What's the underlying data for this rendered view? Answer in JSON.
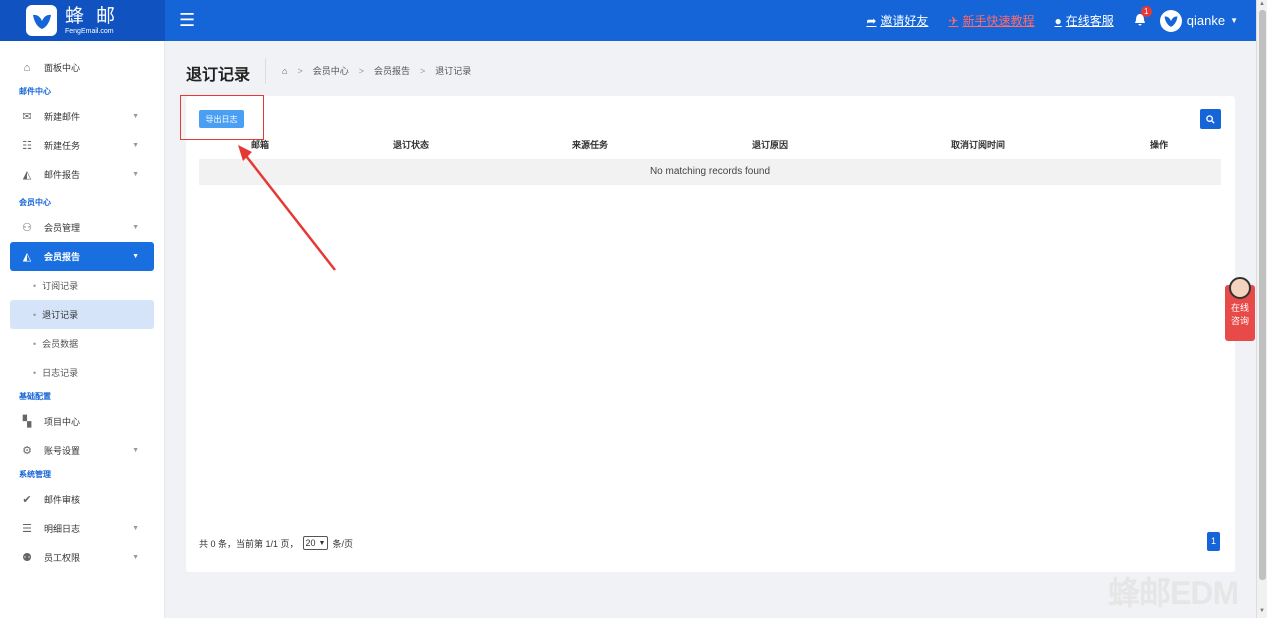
{
  "brand": {
    "name": "蜂 邮",
    "sub": "FengEmail.com"
  },
  "topbar": {
    "invite": "邀请好友",
    "tutorial": "新手快速教程",
    "support": "在线客服",
    "notifications": "1",
    "username": "qianke",
    "colors": {
      "bar": "#1565d8",
      "tutorial": "#ff6a6a"
    }
  },
  "sidebar": {
    "dashboard": "面板中心",
    "mail_section": "邮件中心",
    "new_mail": "新建邮件",
    "new_task": "新建任务",
    "mail_report": "邮件报告",
    "member_section": "会员中心",
    "member_manage": "会员管理",
    "member_report": "会员报告",
    "sub_subscribe": "订阅记录",
    "sub_unsubscribe": "退订记录",
    "sub_member_data": "会员数据",
    "sub_log": "日志记录",
    "basic_section": "基础配置",
    "project_center": "项目中心",
    "account_settings": "账号设置",
    "system_section": "系统管理",
    "mail_review": "邮件审核",
    "detail_log": "明细日志",
    "staff_permission": "员工权限"
  },
  "page": {
    "title": "退订记录",
    "breadcrumb": [
      "会员中心",
      "会员报告",
      "退订记录"
    ]
  },
  "toolbar": {
    "export_label": "导出日志"
  },
  "table": {
    "columns": [
      "邮箱",
      "退订状态",
      "来源任务",
      "退订原因",
      "取消订阅时间",
      "操作"
    ],
    "empty_text": "No matching records found"
  },
  "footer": {
    "summary": "共 0 条，当前第 1/1 页，",
    "page_size": "20",
    "per_page": "条/页",
    "current_page": "1"
  },
  "chat_widget": {
    "label_1": "在线",
    "label_2": "咨询"
  },
  "watermark": "蜂邮EDM"
}
